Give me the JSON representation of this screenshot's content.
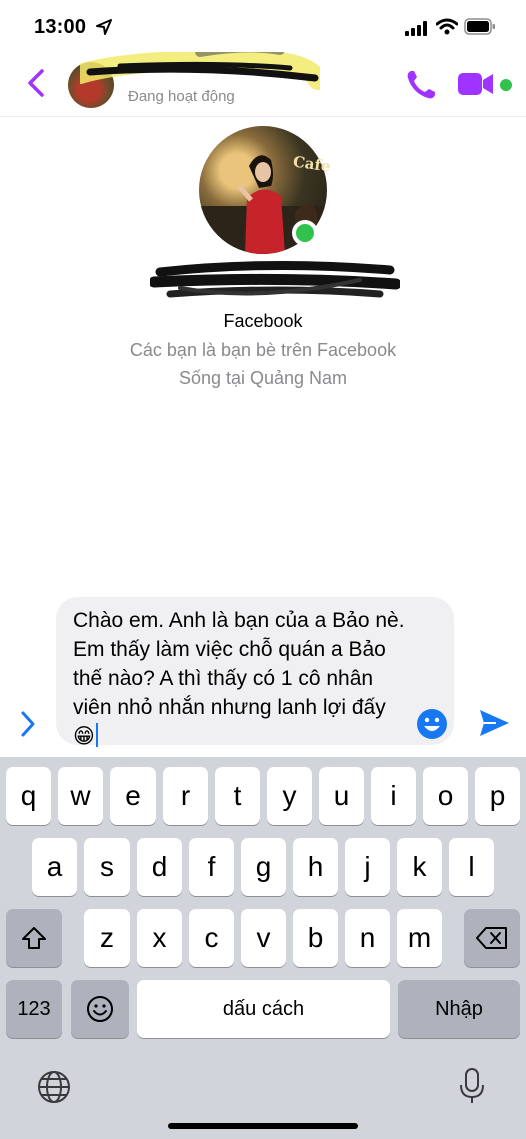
{
  "status_bar": {
    "time": "13:00"
  },
  "header": {
    "status": "Đang hoạt động"
  },
  "profile": {
    "label": "Facebook",
    "friend_text": "Các bạn là bạn bè trên Facebook",
    "location": "Sống tại Quảng Nam",
    "photo_sign": "Cafe"
  },
  "composer": {
    "text": "Chào em. Anh là bạn của a Bảo nè. Em thấy làm việc chỗ quán a Bảo thế nào? A thì thấy có 1 cô nhân viên nhỏ nhắn nhưng lanh lợi đấy 😁"
  },
  "keyboard": {
    "row1": [
      "q",
      "w",
      "e",
      "r",
      "t",
      "y",
      "u",
      "i",
      "o",
      "p"
    ],
    "row2": [
      "a",
      "s",
      "d",
      "f",
      "g",
      "h",
      "j",
      "k",
      "l"
    ],
    "row3": [
      "z",
      "x",
      "c",
      "v",
      "b",
      "n",
      "m"
    ],
    "numbers_key": "123",
    "space_key": "dấu cách",
    "return_key": "Nhập"
  },
  "colors": {
    "accent_purple": "#a033ff",
    "messenger_blue": "#1877f2",
    "online_green": "#31c24d",
    "keyboard_bg": "#d1d4db"
  }
}
